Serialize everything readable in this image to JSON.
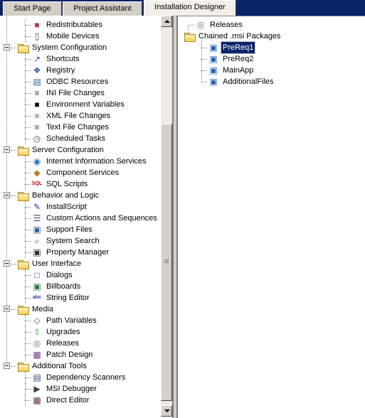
{
  "tabs": [
    {
      "label": "Start Page"
    },
    {
      "label": "Project Assistant"
    },
    {
      "label": "Installation Designer"
    }
  ],
  "colors": {
    "tab_strip": "#0a246a",
    "selection": "#0a246a",
    "window": "#d4d0c8"
  },
  "left_tree": [
    {
      "label": "Redistributables",
      "icon": "redistributables-icon",
      "kind": "child"
    },
    {
      "label": "Mobile Devices",
      "icon": "mobile-device-icon",
      "kind": "child"
    },
    {
      "label": "System Configuration",
      "icon": "folder-icon",
      "kind": "group"
    },
    {
      "label": "Shortcuts",
      "icon": "shortcut-icon",
      "kind": "child"
    },
    {
      "label": "Registry",
      "icon": "registry-icon",
      "kind": "child"
    },
    {
      "label": "ODBC Resources",
      "icon": "database-icon",
      "kind": "child"
    },
    {
      "label": "INI File Changes",
      "icon": "ini-file-icon",
      "kind": "child"
    },
    {
      "label": "Environment Variables",
      "icon": "console-icon",
      "kind": "child"
    },
    {
      "label": "XML File Changes",
      "icon": "xml-file-icon",
      "kind": "child"
    },
    {
      "label": "Text File Changes",
      "icon": "text-file-icon",
      "kind": "child"
    },
    {
      "label": "Scheduled Tasks",
      "icon": "scheduled-task-icon",
      "kind": "child"
    },
    {
      "label": "Server Configuration",
      "icon": "folder-icon",
      "kind": "group"
    },
    {
      "label": "Internet Information Services",
      "icon": "iis-icon",
      "kind": "child"
    },
    {
      "label": "Component Services",
      "icon": "component-services-icon",
      "kind": "child"
    },
    {
      "label": "SQL Scripts",
      "icon": "sql-icon",
      "kind": "child"
    },
    {
      "label": "Behavior and Logic",
      "icon": "folder-icon",
      "kind": "group"
    },
    {
      "label": "InstallScript",
      "icon": "script-icon",
      "kind": "child"
    },
    {
      "label": "Custom Actions and Sequences",
      "icon": "custom-actions-icon",
      "kind": "child"
    },
    {
      "label": "Support Files",
      "icon": "support-files-icon",
      "kind": "child"
    },
    {
      "label": "System Search",
      "icon": "search-icon",
      "kind": "child"
    },
    {
      "label": "Property Manager",
      "icon": "property-manager-icon",
      "kind": "child"
    },
    {
      "label": "User Interface",
      "icon": "folder-icon",
      "kind": "group"
    },
    {
      "label": "Dialogs",
      "icon": "dialog-icon",
      "kind": "child"
    },
    {
      "label": "Billboards",
      "icon": "billboard-icon",
      "kind": "child"
    },
    {
      "label": "String Editor",
      "icon": "string-editor-icon",
      "kind": "child"
    },
    {
      "label": "Media",
      "icon": "folder-icon",
      "kind": "group"
    },
    {
      "label": "Path Variables",
      "icon": "path-variables-icon",
      "kind": "child"
    },
    {
      "label": "Upgrades",
      "icon": "upgrade-icon",
      "kind": "child"
    },
    {
      "label": "Releases",
      "icon": "release-cd-icon",
      "kind": "child"
    },
    {
      "label": "Patch Design",
      "icon": "patch-icon",
      "kind": "child"
    },
    {
      "label": "Additional Tools",
      "icon": "folder-icon",
      "kind": "group"
    },
    {
      "label": "Dependency Scanners",
      "icon": "dependency-scanner-icon",
      "kind": "child"
    },
    {
      "label": "MSI Debugger",
      "icon": "debugger-icon",
      "kind": "child"
    },
    {
      "label": "Direct Editor",
      "icon": "table-editor-icon",
      "kind": "child"
    }
  ],
  "right_tree": {
    "releases": {
      "label": "Releases",
      "icon": "release-cd-icon"
    },
    "chained": {
      "label": "Chained .msi Packages",
      "icon": "folder-open-icon"
    },
    "packages": [
      {
        "label": "PreReq1",
        "icon": "msi-package-icon",
        "selected": true
      },
      {
        "label": "PreReq2",
        "icon": "msi-package-icon",
        "selected": false
      },
      {
        "label": "MainApp",
        "icon": "msi-package-icon",
        "selected": false
      },
      {
        "label": "AdditionalFiles",
        "icon": "msi-package-icon",
        "selected": false
      }
    ]
  }
}
